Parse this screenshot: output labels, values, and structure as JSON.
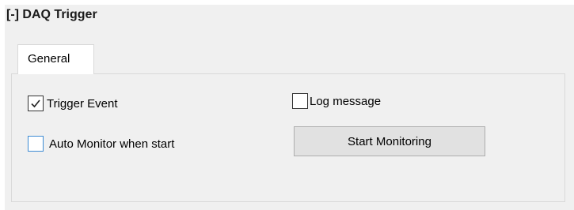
{
  "section": {
    "title": "[-] DAQ Trigger"
  },
  "tabs": [
    {
      "label": "General",
      "selected": true
    }
  ],
  "general": {
    "trigger_event": {
      "label": "Trigger Event",
      "checked": true
    },
    "auto_monitor": {
      "label": "Auto Monitor when start",
      "checked": false
    },
    "log_message": {
      "label": "Log  message",
      "checked": false
    },
    "start_monitoring_label": "Start Monitoring"
  },
  "colors": {
    "panel_background": "#f0f0f0",
    "focus_border": "#3d8bd4",
    "button_background": "#e1e1e1"
  }
}
